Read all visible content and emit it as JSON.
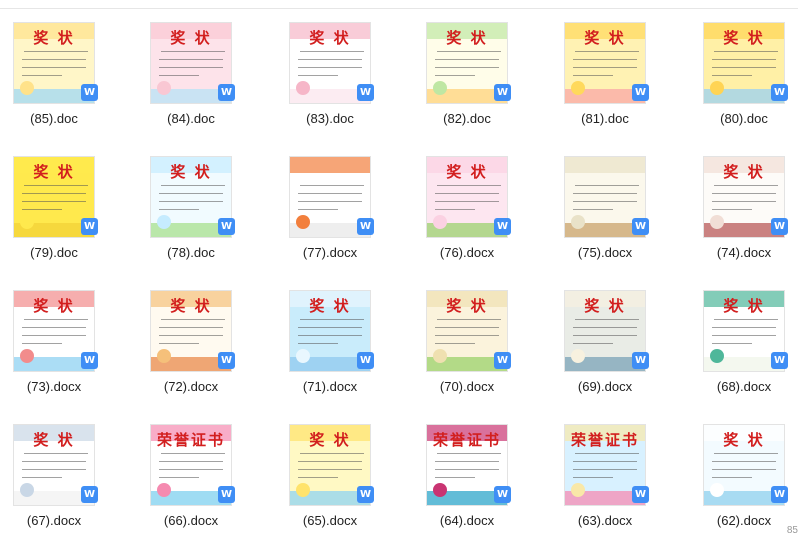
{
  "files": [
    {
      "name": "(85).doc",
      "title": "奖 状",
      "colors": [
        "#fff6c8",
        "#ffe28a",
        "#9fd8f5"
      ],
      "icon": "word-doc-icon"
    },
    {
      "name": "(84).doc",
      "title": "奖 状",
      "colors": [
        "#fde3ea",
        "#f9c7d3",
        "#b7e3f5"
      ],
      "icon": "word-doc-icon"
    },
    {
      "name": "(83).doc",
      "title": "奖 状",
      "colors": [
        "#ffffff",
        "#f6b6c8",
        "#fbe5ee"
      ],
      "icon": "word-doc-icon"
    },
    {
      "name": "(82).doc",
      "title": "奖 状",
      "colors": [
        "#fffde9",
        "#bfe7a3",
        "#ffd27a"
      ],
      "icon": "word-doc-icon"
    },
    {
      "name": "(81).doc",
      "title": "奖 状",
      "colors": [
        "#fff2b3",
        "#ffd95c",
        "#f9a7a7"
      ],
      "icon": "word-doc-icon"
    },
    {
      "name": "(80).doc",
      "title": "奖 状",
      "colors": [
        "#fff0a6",
        "#ffd454",
        "#9ad2f3"
      ],
      "icon": "word-doc-icon"
    },
    {
      "name": "(79).doc",
      "title": "奖 状",
      "colors": [
        "#ffe94d",
        "#ffe94d",
        "#f3d238"
      ],
      "icon": "word-doc-icon"
    },
    {
      "name": "(78).doc",
      "title": "奖 状",
      "colors": [
        "#f1fbff",
        "#c6ecff",
        "#a7e08d"
      ],
      "icon": "word-doc-icon"
    },
    {
      "name": "(77).docx",
      "title": "",
      "colors": [
        "#ffffff",
        "#f27f3d",
        "#e8e8e8"
      ],
      "icon": "word-docx-icon"
    },
    {
      "name": "(76).docx",
      "title": "奖 状",
      "colors": [
        "#fde6f0",
        "#fbd1e2",
        "#9bd26f"
      ],
      "icon": "word-docx-icon"
    },
    {
      "name": "(75).docx",
      "title": "",
      "colors": [
        "#fbf8ec",
        "#e9e2c8",
        "#c9a36b"
      ],
      "icon": "word-docx-icon"
    },
    {
      "name": "(74).docx",
      "title": "奖 状",
      "colors": [
        "#fdfbf8",
        "#f1ded6",
        "#b85a5a"
      ],
      "icon": "word-docx-icon"
    },
    {
      "name": "(73).docx",
      "title": "奖 状",
      "colors": [
        "#ffffff",
        "#f28c8c",
        "#8fd1f2"
      ],
      "icon": "word-docx-icon"
    },
    {
      "name": "(72).docx",
      "title": "奖 状",
      "colors": [
        "#fffaf0",
        "#f5c07a",
        "#e98a4b"
      ],
      "icon": "word-docx-icon"
    },
    {
      "name": "(71).docx",
      "title": "奖 状",
      "colors": [
        "#c9ecfb",
        "#e9f7fe",
        "#8fc9ef"
      ],
      "icon": "word-docx-icon"
    },
    {
      "name": "(70).docx",
      "title": "奖 状",
      "colors": [
        "#fbf3dc",
        "#efe0b0",
        "#9bd16b"
      ],
      "icon": "word-docx-icon"
    },
    {
      "name": "(69).docx",
      "title": "奖 状",
      "colors": [
        "#e9ece6",
        "#f7f1df",
        "#7aa3b7"
      ],
      "icon": "word-docx-icon"
    },
    {
      "name": "(68).docx",
      "title": "奖 状",
      "colors": [
        "#ffffff",
        "#4fb79a",
        "#f0f6ea"
      ],
      "icon": "word-docx-icon"
    },
    {
      "name": "(67).docx",
      "title": "奖 状",
      "colors": [
        "#ffffff",
        "#c9d7e6",
        "#f2f2f2"
      ],
      "icon": "word-docx-icon"
    },
    {
      "name": "(66).docx",
      "title": "荣誉证书",
      "colors": [
        "#ffffff",
        "#f58ab0",
        "#7fd0ef"
      ],
      "icon": "word-docx-icon"
    },
    {
      "name": "(65).docx",
      "title": "奖 状",
      "colors": [
        "#fff9c4",
        "#ffe36b",
        "#8fd3f3"
      ],
      "icon": "word-docx-icon"
    },
    {
      "name": "(64).docx",
      "title": "荣誉证书",
      "colors": [
        "#ffffff",
        "#c93472",
        "#2ea6c9"
      ],
      "icon": "word-docx-icon"
    },
    {
      "name": "(63).docx",
      "title": "荣誉证书",
      "colors": [
        "#d8f1ff",
        "#f9e8a8",
        "#f58bb3"
      ],
      "icon": "word-docx-icon"
    },
    {
      "name": "(62).docx",
      "title": "奖 状",
      "colors": [
        "#f3fbff",
        "#ffffff",
        "#8fd0ee"
      ],
      "icon": "word-docx-icon"
    }
  ],
  "scroll_indicator": "85"
}
